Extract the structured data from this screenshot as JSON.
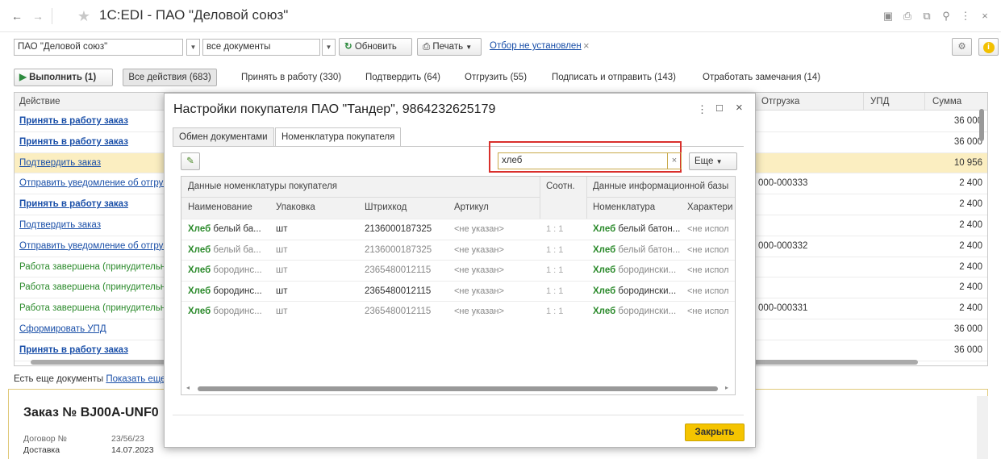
{
  "window": {
    "title": "1C:EDI - ПАО \"Деловой союз\""
  },
  "toolbar1": {
    "org_value": "ПАО \"Деловой союз\"",
    "docs_value": "все документы",
    "refresh_label": "Обновить",
    "print_label": "Печать",
    "filter_link": "Отбор не установлен"
  },
  "toolbar2": {
    "execute_label": "Выполнить (1)",
    "tabs": [
      "Все действия (683)",
      "Принять в работу (330)",
      "Подтвердить (64)",
      "Отгрузить (55)",
      "Подписать и отправить (143)",
      "Отработать замечания (14)"
    ]
  },
  "table": {
    "headers": {
      "action": "Действие",
      "shipment": "Отгрузка",
      "upd": "УПД",
      "sum": "Сумма"
    },
    "rows": [
      {
        "action": "Принять в работу заказ",
        "shipment": "",
        "sum": "36 000",
        "style": "bold"
      },
      {
        "action": "Принять в работу заказ",
        "shipment": "",
        "sum": "36 000",
        "style": "bold"
      },
      {
        "action": "Подтвердить заказ",
        "shipment": "",
        "sum": "10 956",
        "style": "link",
        "selected": true
      },
      {
        "action": "Отправить уведомление об отгрузке",
        "shipment": "000-000333",
        "sum": "2 400",
        "style": "link"
      },
      {
        "action": "Принять в работу заказ",
        "shipment": "",
        "sum": "2 400",
        "style": "bold"
      },
      {
        "action": "Подтвердить заказ",
        "shipment": "",
        "sum": "2 400",
        "style": "link"
      },
      {
        "action": "Отправить уведомление об отгрузке",
        "shipment": "000-000332",
        "sum": "2 400",
        "style": "link"
      },
      {
        "action": "Работа завершена (принудительно)",
        "shipment": "",
        "sum": "2 400",
        "style": "green"
      },
      {
        "action": "Работа завершена (принудительно)",
        "shipment": "",
        "sum": "2 400",
        "style": "green"
      },
      {
        "action": "Работа завершена (принудительно)",
        "shipment": "000-000331",
        "sum": "2 400",
        "style": "green"
      },
      {
        "action": "Сформировать УПД",
        "shipment": "",
        "sum": "36 000",
        "style": "link"
      },
      {
        "action": "Принять в работу заказ",
        "shipment": "",
        "sum": "36 000",
        "style": "bold"
      }
    ]
  },
  "more_docs": {
    "text": "Есть еще документы",
    "link": "Показать еще"
  },
  "order": {
    "title": "Заказ № BJ00A-UNF0",
    "contract_label": "Договор №",
    "contract_value": "23/56/23",
    "delivery_label": "Доставка",
    "delivery_value": "14.07.2023"
  },
  "modal": {
    "title": "Настройки покупателя ПАО \"Тандер\", 9864232625179",
    "tabs": [
      "Обмен документами",
      "Номенклатура покупателя"
    ],
    "search_value": "хлеб",
    "more_label": "Еще",
    "close_label": "Закрыть",
    "groups": {
      "buyer": "Данные номенклатуры покупателя",
      "ratio": "Соотн.",
      "base": "Данные информационной базы"
    },
    "columns": {
      "name": "Наименование",
      "pack": "Упаковка",
      "barcode": "Штрихкод",
      "article": "Артикул",
      "nomenclature": "Номенклатура",
      "charact": "Характери"
    },
    "keyword": "Хлеб",
    "rows": [
      {
        "name_rest": " белый ба...",
        "pack": "шт",
        "barcode": "2136000187325",
        "article": "<не указан>",
        "ratio": "1 : 1",
        "nom_rest": " белый батон...",
        "charact": "<не испол",
        "grey": false
      },
      {
        "name_rest": " белый ба...",
        "pack": "шт",
        "barcode": "2136000187325",
        "article": "<не указан>",
        "ratio": "1 : 1",
        "nom_rest": " белый батон...",
        "charact": "<не испол",
        "grey": true
      },
      {
        "name_rest": " бородинс...",
        "pack": "шт",
        "barcode": "2365480012115",
        "article": "<не указан>",
        "ratio": "1 : 1",
        "nom_rest": " бородински...",
        "charact": "<не испол",
        "grey": true
      },
      {
        "name_rest": " бородинс...",
        "pack": "шт",
        "barcode": "2365480012115",
        "article": "<не указан>",
        "ratio": "1 : 1",
        "nom_rest": " бородински...",
        "charact": "<не испол",
        "grey": false
      },
      {
        "name_rest": " бородинс...",
        "pack": "шт",
        "barcode": "2365480012115",
        "article": "<не указан>",
        "ratio": "1 : 1",
        "nom_rest": " бородински...",
        "charact": "<не испол",
        "grey": true
      }
    ]
  },
  "colors": {
    "link": "#1a4fa8",
    "green": "#2b8a2b",
    "selected_row": "#fbeec1",
    "search_highlight": "#d9302c",
    "close_button": "#f5c400"
  }
}
